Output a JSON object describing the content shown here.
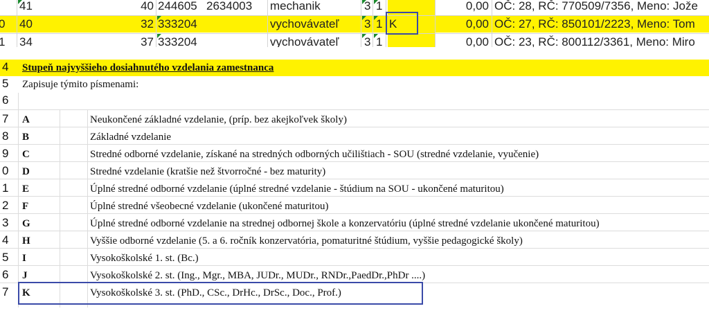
{
  "sheet": {
    "rows": [
      {
        "n": "41",
        "a": "40",
        "b": "244605",
        "c": "2634003",
        "job": "mechanik",
        "d": "3",
        "e": "1",
        "k": "",
        "amt": "0,00",
        "rest": "OČ: 28, RČ: 770509/7356, Meno: Jože"
      },
      {
        "n": "40",
        "a": "32",
        "b": "333204",
        "c": "",
        "job": "vychovávateľ",
        "d": "3",
        "e": "1",
        "k": "K",
        "amt": "0,00",
        "rest": "OČ: 27, RČ: 850101/2223, Meno: Tom"
      },
      {
        "n": "34",
        "a": "37",
        "b": "333204",
        "c": "",
        "job": "vychovávateľ",
        "d": "3",
        "e": "1",
        "k": "",
        "amt": "0,00",
        "rest": "OČ: 23, RČ: 800112/3361, Meno: Miro"
      }
    ],
    "row_edge_marks": [
      "",
      "0",
      "1"
    ]
  },
  "doc": {
    "title": "Stupeň najvyššieho dosiahnutého vzdelania zamestnanca",
    "subtitle": "Zapisuje  týmito písmenami:",
    "row_numbers": {
      "title": "4",
      "subtitle": "5",
      "blank": "6"
    },
    "items": [
      {
        "rn": "7",
        "code": "A",
        "text": "Neukončené základné vzdelanie, (príp. bez akejkoľvek školy)"
      },
      {
        "rn": "8",
        "code": "B",
        "text": "Základné vzdelanie"
      },
      {
        "rn": "9",
        "code": "C",
        "text": "Stredné odborné vzdelanie, získané na stredných odborných učilištiach - SOU (stredné vzdelanie, vyučenie)"
      },
      {
        "rn": "0",
        "code": "D",
        "text": "Stredné vzdelanie (kratšie než štvorročné - bez maturity)"
      },
      {
        "rn": "1",
        "code": "E",
        "text": "Úplné stredné odborné vzdelanie (úplné stredné vzdelanie - štúdium na SOU - ukončené maturitou)"
      },
      {
        "rn": "2",
        "code": "F",
        "text": "Úplné stredné všeobecné vzdelanie (ukončené maturitou)"
      },
      {
        "rn": "3",
        "code": "G",
        "text": "Úplné stredné odborné vzdelanie na strednej odbornej škole a konzervatóriu (úplné stredné vzdelanie ukončené maturitou)"
      },
      {
        "rn": "4",
        "code": "H",
        "text": "Vyššie odborné vzdelanie (5. a 6. ročník konzervatória, pomaturitné štúdium, vyššie pedagogické školy)"
      },
      {
        "rn": "5",
        "code": "I",
        "text": "Vysokoškolské 1. st. (Bc.)"
      },
      {
        "rn": "6",
        "code": "J",
        "text": "Vysokoškolské 2. st. (Ing., Mgr., MBA, JUDr., MUDr., RNDr.,PaedDr.,PhDr ....)"
      },
      {
        "rn": "7",
        "code": "K",
        "text": "Vysokoškolské 3. st. (PhD., CSc., DrHc., DrSc., Doc., Prof.)"
      }
    ]
  },
  "colors": {
    "highlight": "#fff200",
    "frame": "#3a4aa8",
    "comment_marker": "#1b8a2e"
  }
}
